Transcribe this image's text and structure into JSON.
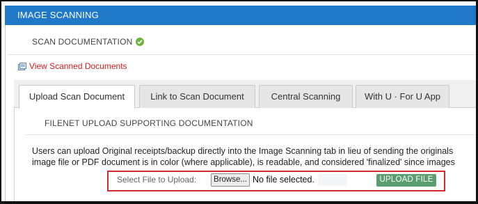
{
  "header": {
    "title": "IMAGE SCANNING"
  },
  "scan_status": {
    "label": "SCAN DOCUMENTATION",
    "icon": "check-circle-icon",
    "color": "#6cb33e"
  },
  "view_link": {
    "label": "View Scanned Documents",
    "icon": "scanned-docs-icon",
    "color": "#d21c1c"
  },
  "tabs": [
    {
      "label": "Upload Scan Document",
      "active": true
    },
    {
      "label": "Link to Scan Document",
      "active": false
    },
    {
      "label": "Central Scanning",
      "active": false
    },
    {
      "label": "With U · For U App",
      "active": false
    }
  ],
  "upload_section": {
    "title": "FILENET UPLOAD SUPPORTING DOCUMENTATION",
    "description_line1": "Users can upload Original receipts/backup directly into the Image Scanning tab in lieu of sending the originals",
    "description_line2": "image file or PDF document is in color (where applicable), is readable, and considered 'finalized' since images",
    "file_label": "Select File to Upload:",
    "browse_label": "Browse...",
    "file_status": "No file selected.",
    "upload_button": "UPLOAD FILE"
  },
  "colors": {
    "header_bg": "#1f78c8",
    "upload_button_bg": "#5a9e6f",
    "highlight_border": "#d22b2b"
  }
}
